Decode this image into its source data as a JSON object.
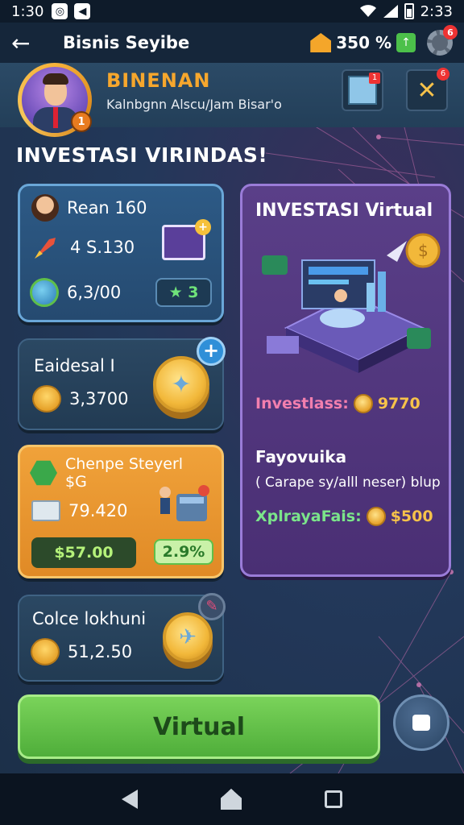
{
  "status_bar": {
    "time": "1:30",
    "battery_time": "2:33"
  },
  "header": {
    "title": "Bisnis Seyibe",
    "coin_percent": "350 %",
    "gear_badge": "6"
  },
  "profile": {
    "name": "BINENAN",
    "subtitle": "Kalnbgnn Alscu/Jam Bisar'o",
    "level": "1"
  },
  "section_title": "INVESTASI VIRINDAS!",
  "cards": {
    "card1": {
      "name": "Rean 160",
      "amount": "4 S.130",
      "value": "6,3/00",
      "badge": "★ 3"
    },
    "card2": {
      "title": "Eaidesal I",
      "amount": "3,3700"
    },
    "card3": {
      "title": "Chenpe Steyerl",
      "subtitle": "$G",
      "amount": "79.420",
      "price": "$57.00",
      "percent": "2.9%"
    },
    "card4": {
      "title": "Colce lokhuni",
      "amount": "51,2.50"
    }
  },
  "virtual_panel": {
    "title": "INVESTASI Virtual",
    "invest_label": "Investlass:",
    "invest_value": "9770",
    "subtitle": "Fayovuika",
    "desc": "( Carape sy/alll neser) blup",
    "xp_label": "XplrayaFais:",
    "xp_value": "$500"
  },
  "bottom": {
    "button_label": "Virtual"
  }
}
